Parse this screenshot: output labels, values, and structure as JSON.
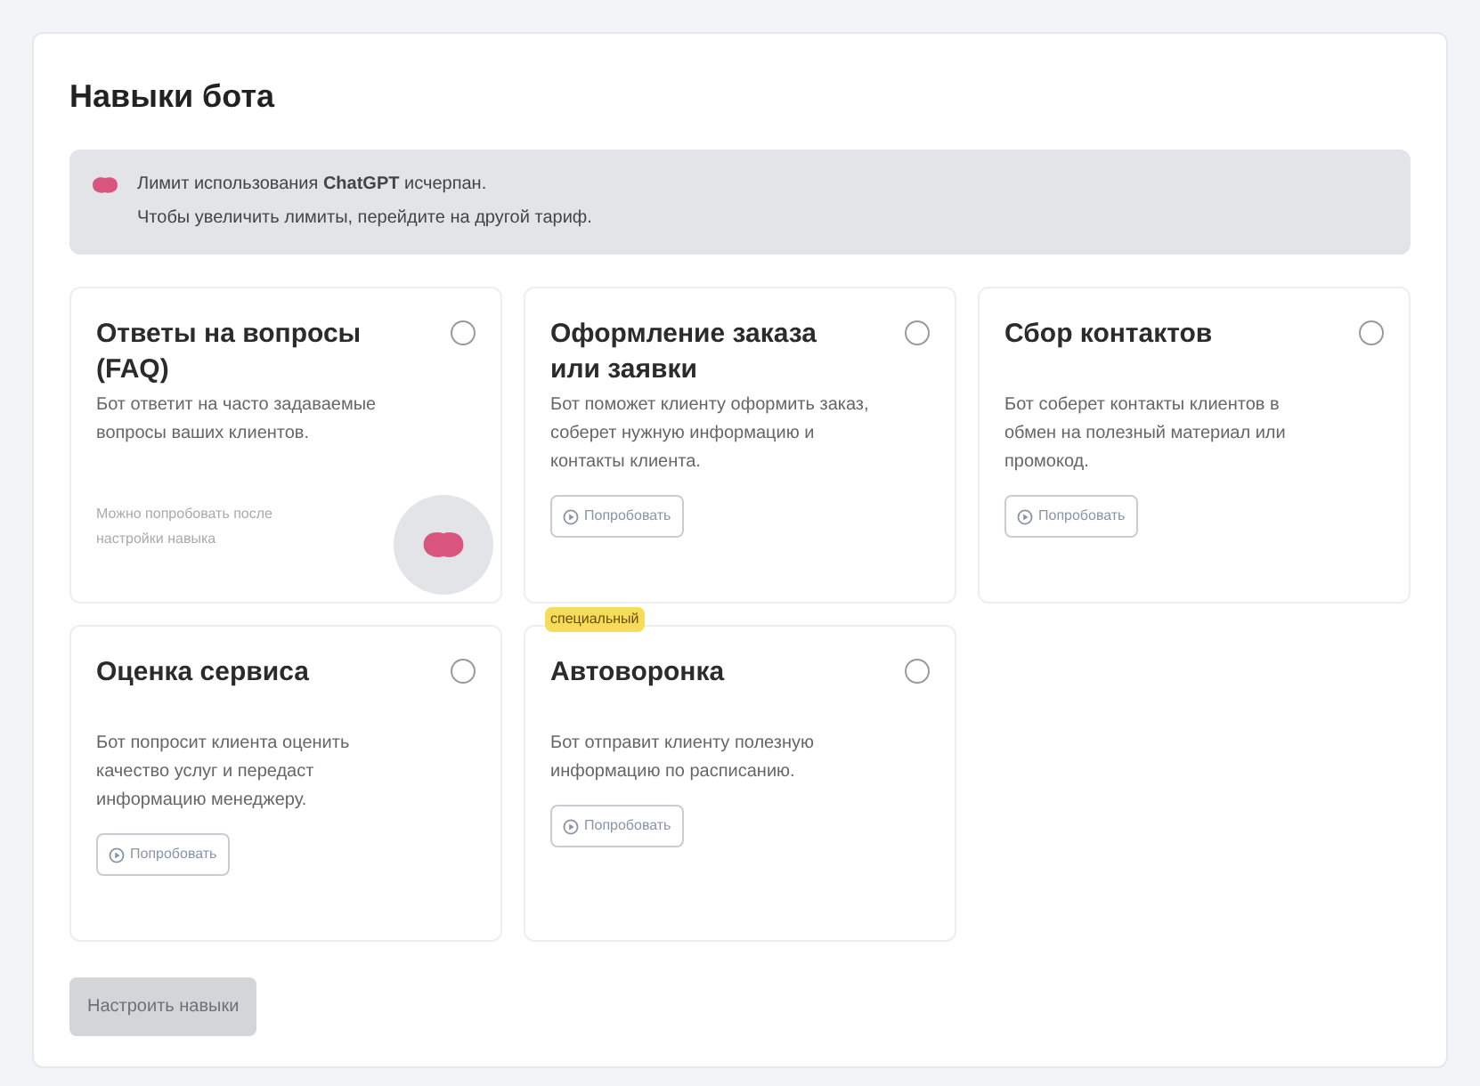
{
  "title": "Навыки бота",
  "alert": {
    "line_1": "Лимит использования **ChatGPT** исчерпан.",
    "line_2": "Чтобы увеличить лимиты, перейдите на другой тариф."
  },
  "skills": [
    {
      "title": "Ответы на вопросы (FAQ)",
      "description": "Бот ответит на часто задаваемые вопросы ваших клиентов.",
      "selected": false,
      "note": "Можно попробовать после настройки навыка"
    },
    {
      "title": "Оформление заказа или заявки",
      "description": "Бот поможет клиенту оформить заказ, соберет нужную информацию и контакты клиента.",
      "selected": false,
      "try_button": "Попробовать"
    },
    {
      "title": "Сбор контактов",
      "description": "Бот соберет контакты клиентов в обмен на полезный материал или промокод.",
      "selected": false,
      "try_button": "Попробовать"
    },
    {
      "title": "Оценка сервиса",
      "description": "Бот попросит клиента оценить качество услуг и передаст информацию менеджеру.",
      "selected": false,
      "try_button": "Попробовать"
    },
    {
      "title": "Автоворонка",
      "description": "Бот отправит клиенту полезную информацию по расписанию.",
      "selected": false,
      "try_button": "Попробовать",
      "badge": "специальный"
    }
  ],
  "setup_button": {
    "label": "Настроить навыки",
    "disabled": true
  }
}
